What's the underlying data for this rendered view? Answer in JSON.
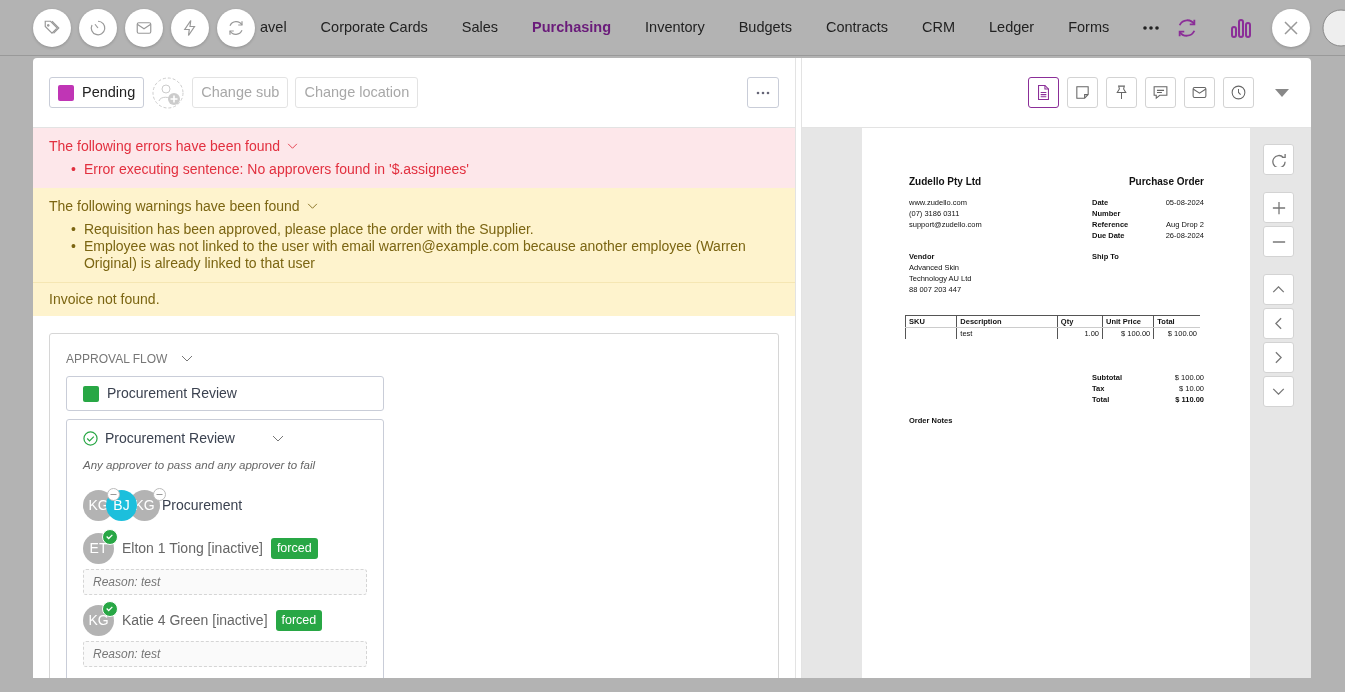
{
  "top_nav": {
    "items": [
      {
        "label": "avel",
        "selected": false
      },
      {
        "label": "Corporate Cards",
        "selected": false
      },
      {
        "label": "Sales",
        "selected": false
      },
      {
        "label": "Purchasing",
        "selected": true
      },
      {
        "label": "Inventory",
        "selected": false
      },
      {
        "label": "Budgets",
        "selected": false
      },
      {
        "label": "Contracts",
        "selected": false
      },
      {
        "label": "CRM",
        "selected": false
      },
      {
        "label": "Ledger",
        "selected": false
      },
      {
        "label": "Forms",
        "selected": false
      }
    ]
  },
  "header": {
    "status": {
      "label": "Pending",
      "color": "#c035b5"
    },
    "buttons": [
      {
        "label": "Change sub",
        "disabled": true
      },
      {
        "label": "Change location",
        "disabled": true
      }
    ]
  },
  "errors": {
    "title": "The following errors have been found",
    "items": [
      {
        "bullet": "•",
        "text": "Error executing sentence: No approvers found in '$.assignees'"
      }
    ]
  },
  "warnings": {
    "title": "The following warnings have been found",
    "items": [
      {
        "bullet": "•",
        "text": "Requisition has been approved, please place the order with the Supplier."
      },
      {
        "bullet": "•",
        "text": "Employee was not linked to the user with email warren@example.com because another employee (Warren Original) is already linked to that user"
      }
    ]
  },
  "notice": "Invoice not found.",
  "approval_flow": {
    "title": "APPROVAL FLOW",
    "stage": {
      "label": "Procurement Review",
      "color": "#28a745"
    },
    "step": {
      "title": "Procurement Review",
      "rule": "Any approver to pass and any approver to fail",
      "group": {
        "name": "Procurement",
        "members": [
          {
            "initials": "KG",
            "color": "#b3b3b3"
          },
          {
            "initials": "BJ",
            "color": "#1cbfdc"
          },
          {
            "initials": "KG",
            "color": "#b3b3b3"
          }
        ]
      },
      "approvers": [
        {
          "initials": "ET",
          "name": "Elton 1 Tiong [inactive]",
          "tag": "forced",
          "reason": "Reason: test"
        },
        {
          "initials": "KG",
          "name": "Katie 4 Green [inactive]",
          "tag": "forced",
          "reason": "Reason: test"
        }
      ]
    }
  },
  "viewer_tabs": [
    {
      "selected": true
    },
    {
      "selected": false
    },
    {
      "selected": false
    },
    {
      "selected": false
    },
    {
      "selected": false
    },
    {
      "selected": false
    }
  ],
  "document": {
    "company": "Zudello Pty Ltd",
    "title": "Purchase Order",
    "contact": [
      "www.zudello.com",
      "(07) 3186 0311",
      "support@zudello.com"
    ],
    "meta": [
      {
        "label": "Date",
        "value": "05-08-2024"
      },
      {
        "label": "Number"
      },
      {
        "label": "Reference",
        "value": "Aug Drop 2"
      },
      {
        "label": "Due Date",
        "value": "26-08-2024"
      }
    ],
    "vendor_label": "Vendor",
    "vendor": [
      "Advanced Skin",
      "Technology AU Ltd",
      "88 007 203 447"
    ],
    "ship_to_label": "Ship To",
    "table": {
      "columns": [
        "SKU",
        "Description",
        "Qty",
        "Unit Price",
        "Total"
      ],
      "rows": [
        [
          "",
          "test",
          "1.00",
          "$ 100.00",
          "$ 100.00"
        ]
      ]
    },
    "totals": [
      {
        "label": "Subtotal",
        "value": "$ 100.00"
      },
      {
        "label": "Tax",
        "value": "$ 10.00"
      },
      {
        "label": "Total",
        "value": "$ 110.00"
      }
    ],
    "notes_label": "Order Notes"
  }
}
